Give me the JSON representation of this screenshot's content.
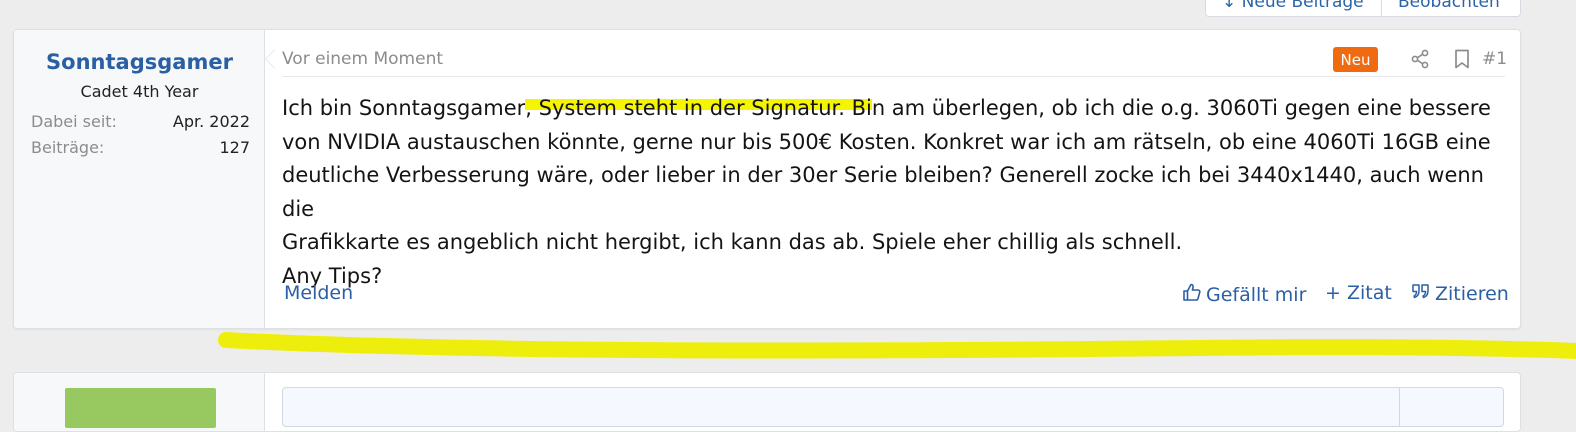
{
  "top_buttons": {
    "new_posts": "↓ Neue Beiträge",
    "watch": "Beobachten"
  },
  "post": {
    "user": {
      "name": "Sonntagsgamer",
      "title": "Cadet 4th Year",
      "stats": [
        {
          "key": "Dabei seit:",
          "value": "Apr. 2022"
        },
        {
          "key": "Beiträge:",
          "value": "127"
        }
      ]
    },
    "timestamp": "Vor einem Moment",
    "badge": "Neu",
    "post_number": "#1",
    "body": {
      "line1_pre": "Ich bin Sonntagsgamer",
      "line1_highlight": ", System steht in der Signatur. Bi",
      "line1_post": "n am überlegen, ob ich die o.g. 3060Ti gegen eine bessere",
      "line2": "von NVIDIA austauschen könnte, gerne nur bis 500€ Kosten. Konkret war ich am rätseln, ob eine 4060Ti 16GB eine",
      "line3": "deutliche Verbesserung wäre, oder lieber in der 30er Serie bleiben? Generell zocke ich bei 3440x1440, auch wenn die",
      "line4": "Grafikkarte es angeblich nicht hergibt, ich kann das ab. Spiele eher chillig als schnell.",
      "line5": "Any Tips?"
    },
    "actions": {
      "report": "Melden",
      "like": "Gefällt mir",
      "quote_plus": "+ Zitat",
      "quote": "Zitieren"
    },
    "icons": {
      "share": "share-icon",
      "bookmark": "bookmark-icon",
      "like": "thumbs-up-icon",
      "quote": "quote-icon"
    },
    "colors": {
      "accent": "#2b5fa4",
      "badge": "#f06a11",
      "highlight": "#f6f500"
    }
  }
}
